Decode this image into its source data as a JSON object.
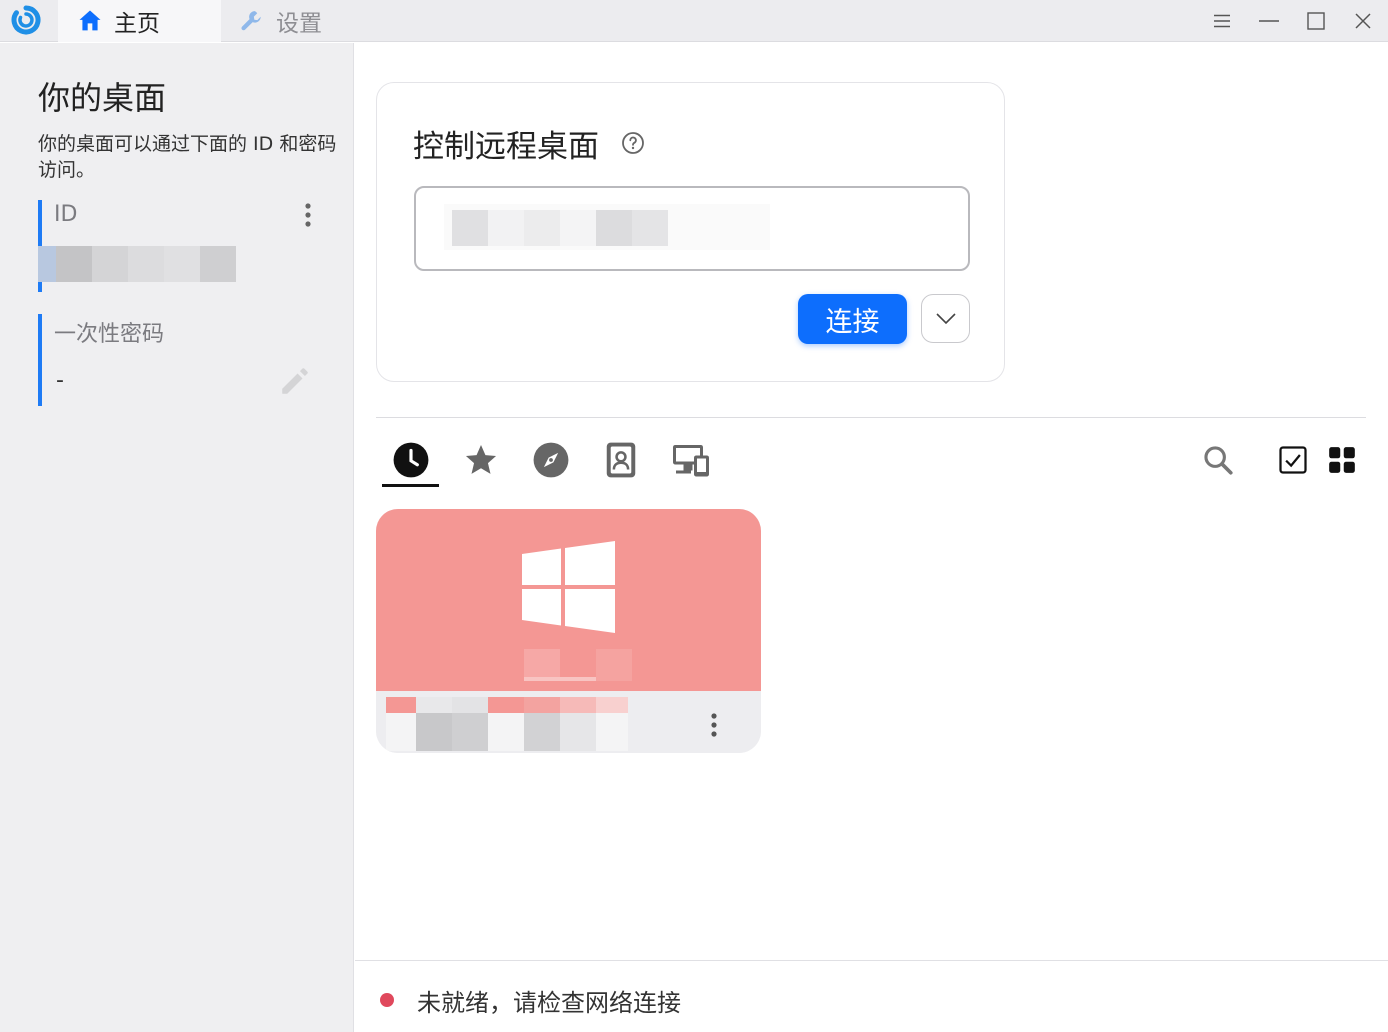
{
  "titlebar": {
    "tabs": [
      {
        "label": "主页",
        "icon": "home-icon",
        "active": true
      },
      {
        "label": "设置",
        "icon": "wrench-icon",
        "active": false
      }
    ],
    "controls": [
      "menu-icon",
      "minimize-icon",
      "maximize-icon",
      "close-icon"
    ]
  },
  "left": {
    "title": "你的桌面",
    "description": "你的桌面可以通过下面的 ID 和密码访问。",
    "id_label": "ID",
    "password_label": "一次性密码",
    "password_value": "-"
  },
  "card": {
    "title": "控制远程桌面",
    "connect_label": "连接"
  },
  "peer_tabs": [
    "recent-clock-icon",
    "favorites-star-icon",
    "discovered-compass-icon",
    "address-book-icon",
    "group-devices-icon"
  ],
  "toolbar": [
    "search-icon",
    "select-checkbox-icon",
    "grid-view-icon"
  ],
  "status": {
    "text": "未就绪，请检查网络连接",
    "color": "#e0485c"
  },
  "colors": {
    "accent": "#0d6efd",
    "peer_card": "#f49794"
  }
}
